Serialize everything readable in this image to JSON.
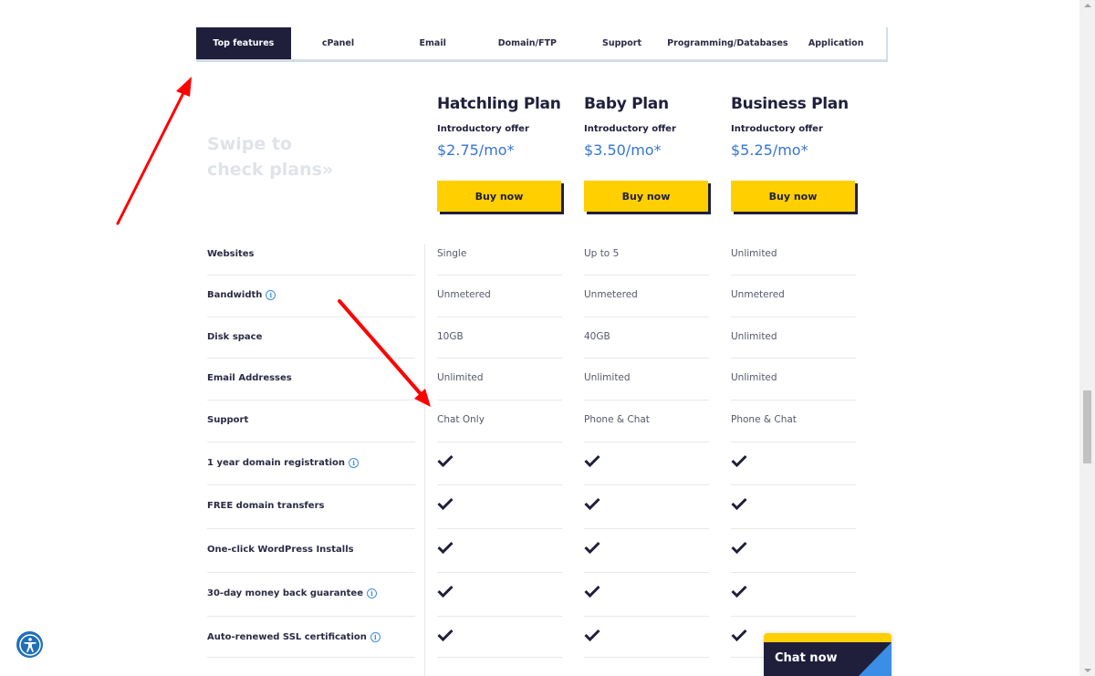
{
  "tabs": [
    {
      "label": "Top features",
      "active": true
    },
    {
      "label": "cPanel",
      "active": false
    },
    {
      "label": "Email",
      "active": false
    },
    {
      "label": "Domain/FTP",
      "active": false
    },
    {
      "label": "Support",
      "active": false
    },
    {
      "label": "Programming/Databases",
      "active": false
    },
    {
      "label": "Application",
      "active": false
    }
  ],
  "swipe_hint": {
    "line1": "Swipe to",
    "line2": "check plans»"
  },
  "plans": [
    {
      "name": "Hatchling Plan",
      "offer": "Introductory offer",
      "price": "$2.75/mo*",
      "button": "Buy now"
    },
    {
      "name": "Baby Plan",
      "offer": "Introductory offer",
      "price": "$3.50/mo*",
      "button": "Buy now"
    },
    {
      "name": "Business Plan",
      "offer": "Introductory offer",
      "price": "$5.25/mo*",
      "button": "Buy now"
    }
  ],
  "features": [
    {
      "label": "Websites",
      "info": false,
      "values": [
        "Single",
        "Up to 5",
        "Unlimited"
      ]
    },
    {
      "label": "Bandwidth",
      "info": true,
      "values": [
        "Unmetered",
        "Unmetered",
        "Unmetered"
      ]
    },
    {
      "label": "Disk space",
      "info": false,
      "values": [
        "10GB",
        "40GB",
        "Unlimited"
      ]
    },
    {
      "label": "Email Addresses",
      "info": false,
      "values": [
        "Unlimited",
        "Unlimited",
        "Unlimited"
      ]
    },
    {
      "label": "Support",
      "info": false,
      "values": [
        "Chat Only",
        "Phone & Chat",
        "Phone & Chat"
      ]
    },
    {
      "label": "1 year domain registration",
      "info": true,
      "values": [
        "check",
        "check",
        "check"
      ]
    },
    {
      "label": "FREE domain transfers",
      "info": false,
      "values": [
        "check",
        "check",
        "check"
      ]
    },
    {
      "label": "One-click WordPress Installs",
      "info": false,
      "values": [
        "check",
        "check",
        "check"
      ]
    },
    {
      "label": "30-day money back guarantee",
      "info": true,
      "values": [
        "check",
        "check",
        "check"
      ]
    },
    {
      "label": "Auto-renewed SSL certification",
      "info": true,
      "values": [
        "check",
        "check",
        "check"
      ]
    }
  ],
  "chat_widget": {
    "label": "Chat now"
  },
  "accessibility": {
    "icon": "accessibility-icon"
  },
  "colors": {
    "navy": "#1f1f3c",
    "yellow": "#ffcf00",
    "price_blue": "#3575d3",
    "info_blue": "#3a8ee6",
    "annotation_red": "#ff0000"
  }
}
